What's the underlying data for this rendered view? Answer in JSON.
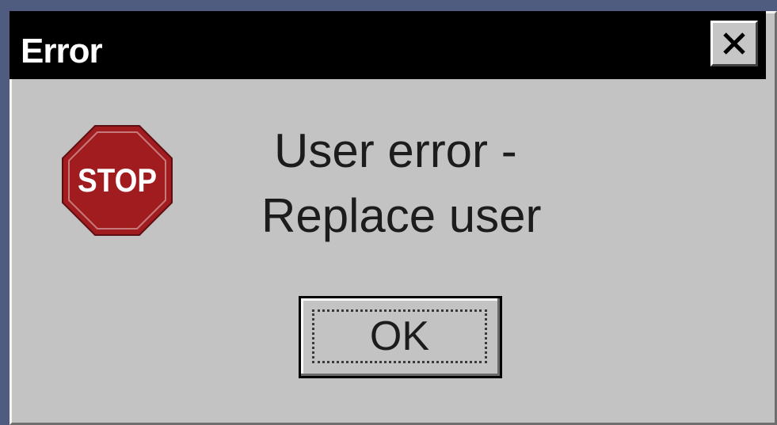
{
  "window": {
    "title": "Error",
    "close_icon": "close-icon"
  },
  "dialog": {
    "icon": "stop-sign-icon",
    "icon_text": "STOP",
    "message_lines": [
      "User error -",
      "Replace user"
    ],
    "ok_label": "OK"
  },
  "colors": {
    "titlebar": "#000000",
    "dialog_face": "#c3c3c3",
    "stop_sign": "#a11c1f",
    "desktop": "#4f5b7f"
  }
}
